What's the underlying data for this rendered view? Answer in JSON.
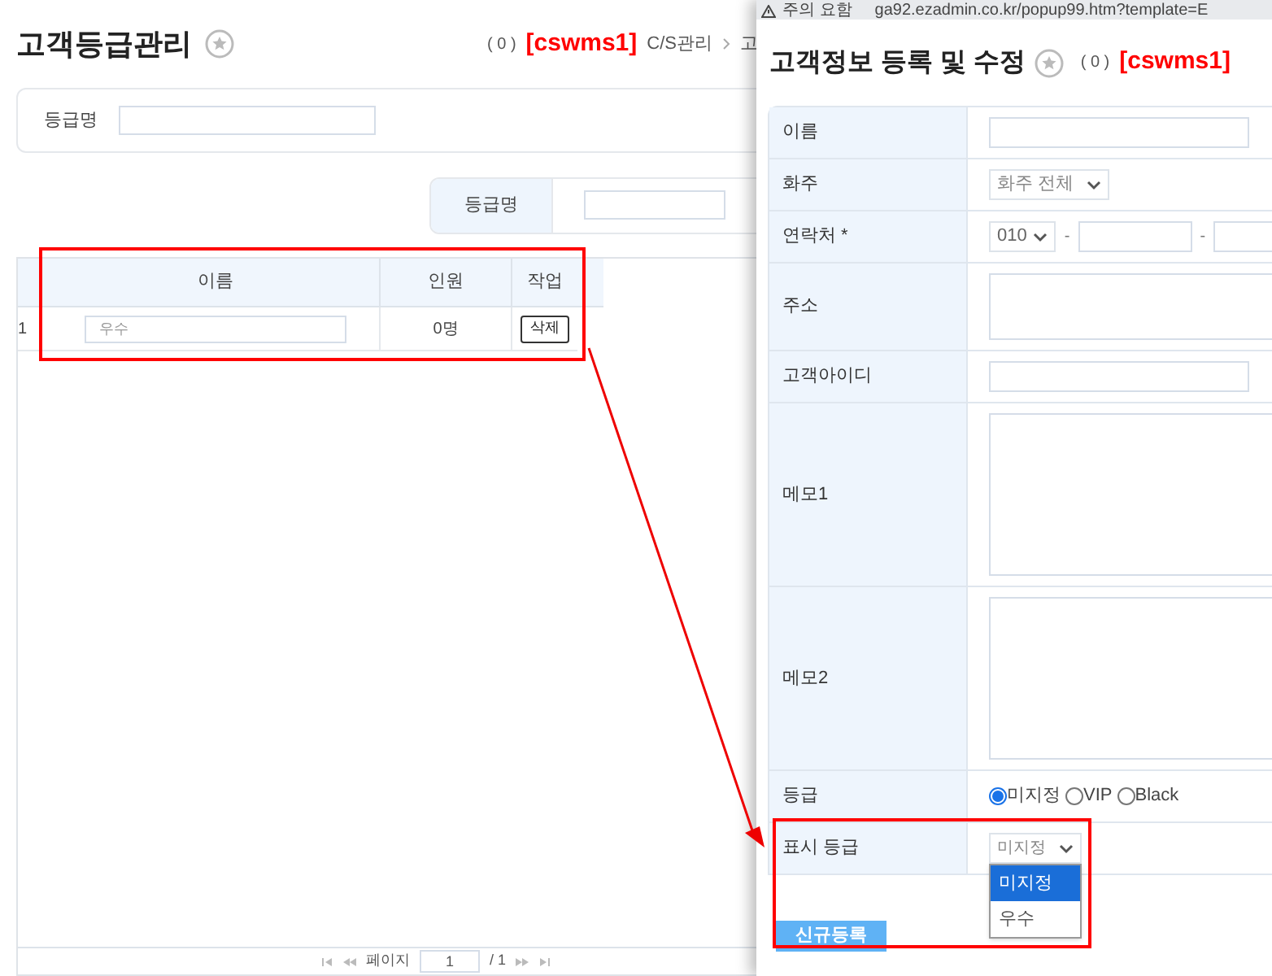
{
  "page": {
    "title": "고객등급관리",
    "count": "( 0 )",
    "user": "[cswms1]",
    "breadcrumb": [
      "C/S관리",
      "고"
    ]
  },
  "search": {
    "label": "등급명"
  },
  "filter": {
    "label": "등급명"
  },
  "table": {
    "columns": [
      "이름",
      "인원",
      "작업"
    ],
    "rows": [
      {
        "index": "1",
        "name": "우수",
        "count": "0명",
        "action": "삭제"
      }
    ]
  },
  "pagination": {
    "label": "페이지",
    "page": "1",
    "total": "/ 1"
  },
  "popup": {
    "security": "주의 요함",
    "url": "ga92.ezadmin.co.kr/popup99.htm?template=E",
    "title": "고객정보 등록 및 수정",
    "count": "( 0 )",
    "user": "[cswms1]",
    "fields": [
      {
        "kind": "text",
        "label": "이름"
      },
      {
        "kind": "select",
        "label": "화주",
        "value": "화주 전체"
      },
      {
        "kind": "phone",
        "label": "연락처 *",
        "value": "010",
        "separators": [
          "-",
          "-"
        ]
      },
      {
        "kind": "address",
        "label": "주소"
      },
      {
        "kind": "text",
        "label": "고객아이디"
      },
      {
        "kind": "memo",
        "label": "메모1"
      },
      {
        "kind": "memo",
        "label": "메모2"
      },
      {
        "kind": "radio",
        "label": "등급",
        "options": [
          {
            "label": "미지정",
            "selected": true
          },
          {
            "label": "VIP",
            "selected": false
          },
          {
            "label": "Black",
            "selected": false
          }
        ]
      },
      {
        "kind": "dropdown",
        "label": "표시 등급",
        "value": "미지정",
        "options": [
          {
            "label": "미지정",
            "selected": true
          },
          {
            "label": "우수",
            "selected": false
          }
        ]
      }
    ],
    "button": "신규등록"
  }
}
